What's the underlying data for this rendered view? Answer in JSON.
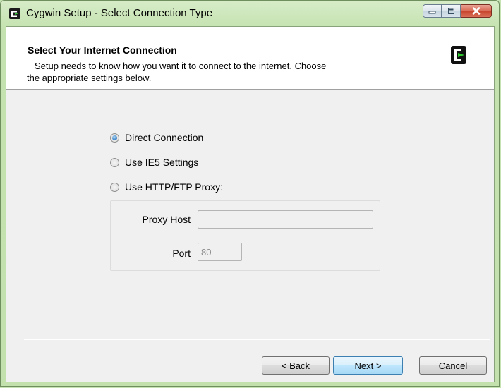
{
  "window": {
    "title": "Cygwin Setup - Select Connection Type"
  },
  "icons": {
    "app": "cygwin-icon",
    "logo": "cygwin-logo",
    "minimize": "minimize-icon",
    "maximize": "maximize-icon",
    "close": "close-icon"
  },
  "colors": {
    "title_bar": "#c6e3b3",
    "close_button": "#c7422a",
    "radio_selected": "#3d86c9",
    "default_button_border": "#3c7fb1"
  },
  "header": {
    "title": "Select Your Internet Connection",
    "description_line1": "Setup needs to know how you want it to connect to the internet.  Choose",
    "description_line2": "the appropriate settings below."
  },
  "connection_options": [
    {
      "label": "Direct Connection",
      "selected": true
    },
    {
      "label": "Use IE5 Settings",
      "selected": false
    },
    {
      "label": "Use HTTP/FTP Proxy:",
      "selected": false
    }
  ],
  "proxy": {
    "host_label": "Proxy Host",
    "host_value": "",
    "port_label": "Port",
    "port_value": "80",
    "enabled": false
  },
  "buttons": {
    "back": "< Back",
    "next": "Next >",
    "cancel": "Cancel"
  }
}
